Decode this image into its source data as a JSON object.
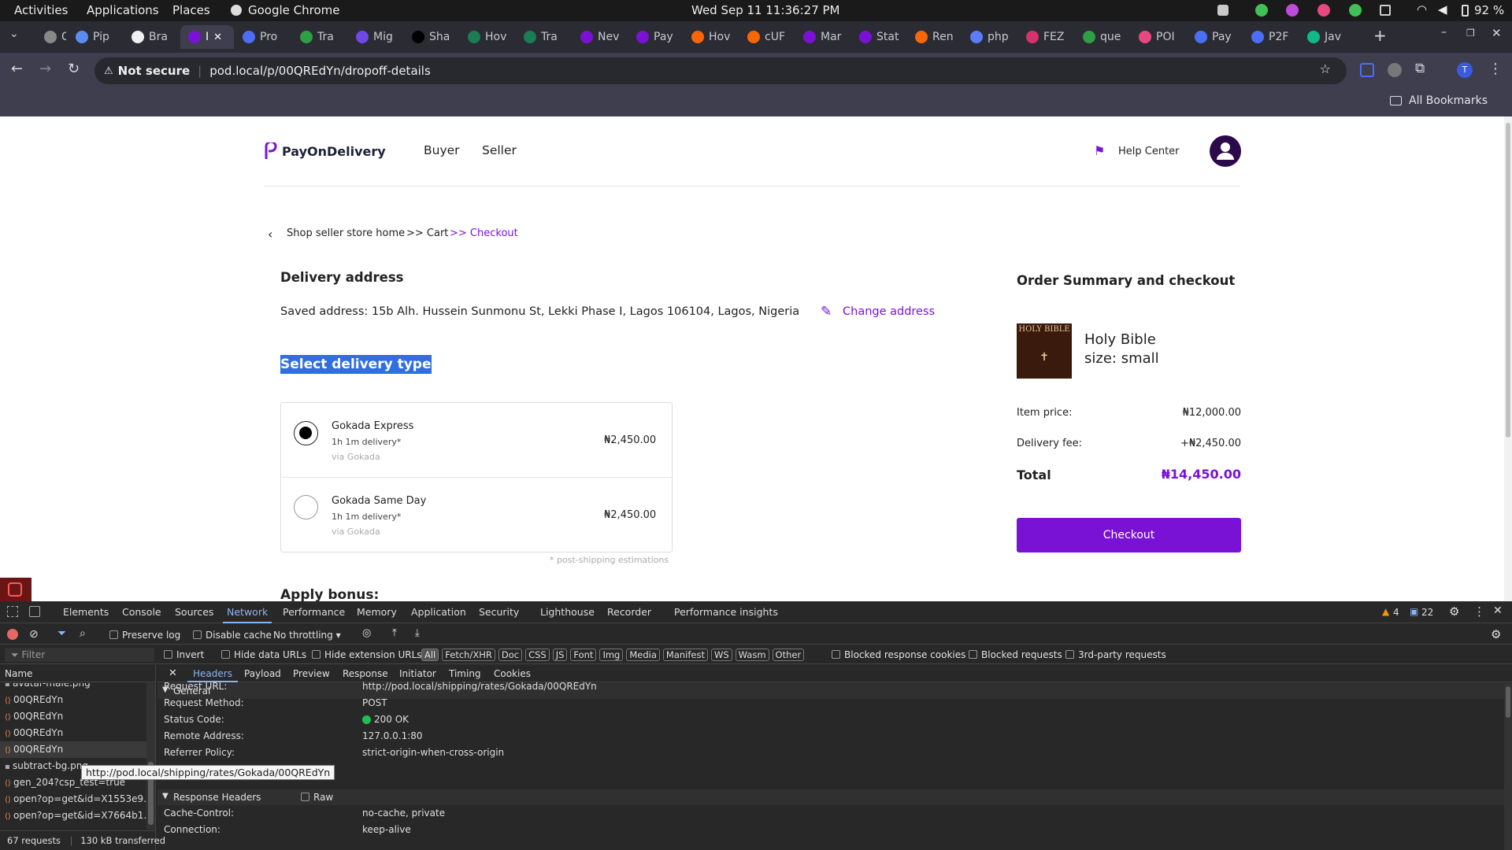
{
  "system_bar": {
    "activities": "Activities",
    "applications": "Applications",
    "places": "Places",
    "app_name": "Google Chrome",
    "clock": "Wed Sep 11  11:36:27 PM",
    "battery": "92 %"
  },
  "browser": {
    "tabs": [
      {
        "label": "C",
        "color": "#888"
      },
      {
        "label": "Pip",
        "color": "#5b8def"
      },
      {
        "label": "Bra",
        "color": "#f0f0f0"
      },
      {
        "label": "I",
        "color": "#7a12d6"
      },
      {
        "label": "Pro",
        "color": "#4c6ef5"
      },
      {
        "label": "Tra",
        "color": "#2f9e44"
      },
      {
        "label": "Mig",
        "color": "#7048e8"
      },
      {
        "label": "Sha",
        "color": "#000000"
      },
      {
        "label": "Hov",
        "color": "#1c7c54"
      },
      {
        "label": "Tra",
        "color": "#1c7c54"
      },
      {
        "label": "Nev",
        "color": "#7a12d6"
      },
      {
        "label": "Pay",
        "color": "#7a12d6"
      },
      {
        "label": "Hov",
        "color": "#f76707"
      },
      {
        "label": "cUF",
        "color": "#f76707"
      },
      {
        "label": "Mar",
        "color": "#7a12d6"
      },
      {
        "label": "Stat",
        "color": "#7a12d6"
      },
      {
        "label": "Ren",
        "color": "#f76707"
      },
      {
        "label": "php",
        "color": "#5c7cfa"
      },
      {
        "label": "FEZ",
        "color": "#d6336c"
      },
      {
        "label": "que",
        "color": "#2f9e44"
      },
      {
        "label": "POI",
        "color": "#e64980"
      },
      {
        "label": "Pay",
        "color": "#4c6ef5"
      },
      {
        "label": "P2F",
        "color": "#4c6ef5"
      },
      {
        "label": "Jav",
        "color": "#12b886"
      }
    ],
    "security_label": "Not secure",
    "url": "pod.local/p/00QREdYn/dropoff-details",
    "all_bookmarks": "All Bookmarks",
    "profile_initial": "T"
  },
  "site": {
    "brand": "PayOnDelivery",
    "nav": [
      "Buyer",
      "Seller"
    ],
    "help": "Help Center",
    "breadcrumb": {
      "home": "Shop seller store home",
      "cart": ">> Cart",
      "checkout": ">> Checkout"
    },
    "delivery_heading": "Delivery address",
    "saved_address": "Saved address: 15b Alh. Hussein Sunmonu St, Lekki Phase I, Lagos 106104, Lagos, Nigeria",
    "change_address": "Change address",
    "select_type": "Select delivery type",
    "options": [
      {
        "name": "Gokada Express",
        "eta": "1h 1m delivery*",
        "via": "via Gokada",
        "price": "₦2,450.00",
        "selected": true
      },
      {
        "name": "Gokada Same Day",
        "eta": "1h 1m delivery*",
        "via": "via Gokada",
        "price": "₦2,450.00",
        "selected": false
      }
    ],
    "estimation_note": "* post-shipping estimations",
    "bonus_heading": "Apply bonus:",
    "summary": {
      "heading": "Order Summary and checkout",
      "product_name": "Holy Bible",
      "product_size": "size: small",
      "book_cover_text": "HOLY BIBLE",
      "item_price_label": "Item price:",
      "item_price": "₦12,000.00",
      "delivery_fee_label": "Delivery fee:",
      "delivery_fee": "+₦2,450.00",
      "total_label": "Total",
      "total": "₦14,450.00",
      "checkout": "Checkout"
    },
    "accent": "#7a12d6"
  },
  "devtools": {
    "tabs": [
      "Elements",
      "Console",
      "Sources",
      "Network",
      "Performance",
      "Memory",
      "Application",
      "Security",
      "Lighthouse",
      "Recorder",
      "Performance insights"
    ],
    "active_tab": "Network",
    "warnings": "4",
    "messages": "22",
    "preserve_log": "Preserve log",
    "disable_cache": "Disable cache",
    "throttling": "No throttling",
    "filter_placeholder": "Filter",
    "filter_opts": [
      "Invert",
      "Hide data URLs",
      "Hide extension URLs"
    ],
    "type_chips": [
      "All",
      "Fetch/XHR",
      "Doc",
      "CSS",
      "JS",
      "Font",
      "Img",
      "Media",
      "Manifest",
      "WS",
      "Wasm",
      "Other"
    ],
    "blocked": [
      "Blocked response cookies",
      "Blocked requests",
      "3rd-party requests"
    ],
    "name_header": "Name",
    "requests": [
      "avatar-male.png",
      "00QREdYn",
      "00QREdYn",
      "00QREdYn",
      "00QREdYn",
      "subtract-bg.png",
      "gen_204?csp_test=true",
      "open?op=get&id=X1553e9…",
      "open?op=get&id=X7664b1…"
    ],
    "status_bar": {
      "count": "67 requests",
      "transferred": "130 kB transferred"
    },
    "detail_tabs": [
      "Headers",
      "Payload",
      "Preview",
      "Response",
      "Initiator",
      "Timing",
      "Cookies"
    ],
    "general_title": "General",
    "general": [
      {
        "k": "Request URL:",
        "v": "http://pod.local/shipping/rates/Gokada/00QREdYn"
      },
      {
        "k": "Request Method:",
        "v": "POST"
      },
      {
        "k": "Status Code:",
        "v": "200 OK"
      },
      {
        "k": "Remote Address:",
        "v": "127.0.0.1:80"
      },
      {
        "k": "Referrer Policy:",
        "v": "strict-origin-when-cross-origin"
      }
    ],
    "tooltip": "http://pod.local/shipping/rates/Gokada/00QREdYn",
    "response_headers_title": "Response Headers",
    "raw": "Raw",
    "response_headers": [
      {
        "k": "Cache-Control:",
        "v": "no-cache, private"
      },
      {
        "k": "Connection:",
        "v": "keep-alive"
      }
    ]
  }
}
